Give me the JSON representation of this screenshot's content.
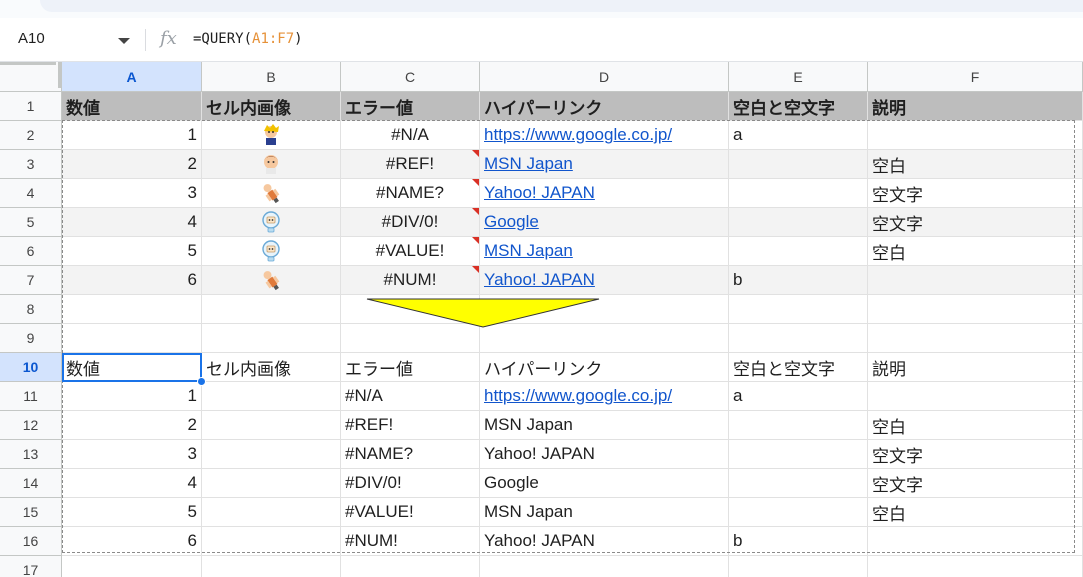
{
  "name_box": {
    "value": "A10"
  },
  "formula_bar": {
    "prefix": "=QUERY(",
    "range": "A1:F7",
    "suffix": ")"
  },
  "columns": [
    "A",
    "B",
    "C",
    "D",
    "E",
    "F"
  ],
  "rows": [
    "1",
    "2",
    "3",
    "4",
    "5",
    "6",
    "7",
    "8",
    "9",
    "10",
    "11",
    "12",
    "13",
    "14",
    "15",
    "16",
    "17"
  ],
  "header": [
    "数値",
    "セル内画像",
    "エラー値",
    "ハイパーリンク",
    "空白と空文字",
    "説明"
  ],
  "source_rows": [
    {
      "num": "1",
      "image": "anime-character-icon-1",
      "error": "#N/A",
      "link": "https://www.google.co.jp/",
      "blank": "a",
      "desc": ""
    },
    {
      "num": "2",
      "image": "anime-character-icon-2",
      "error": "#REF!",
      "link": "MSN Japan",
      "blank": "",
      "desc": "空白"
    },
    {
      "num": "3",
      "image": "anime-character-icon-3",
      "error": "#NAME?",
      "link": "Yahoo! JAPAN",
      "blank": "",
      "desc": "空文字"
    },
    {
      "num": "4",
      "image": "robot-icon",
      "error": "#DIV/0!",
      "link": "Google",
      "blank": "",
      "desc": "空文字"
    },
    {
      "num": "5",
      "image": "robot-icon",
      "error": "#VALUE!",
      "link": "MSN Japan",
      "blank": "",
      "desc": "空白"
    },
    {
      "num": "6",
      "image": "anime-character-icon-3",
      "error": "#NUM!",
      "link": "Yahoo! JAPAN",
      "blank": "b",
      "desc": ""
    }
  ],
  "result_header": [
    "数値",
    "セル内画像",
    "エラー値",
    "ハイパーリンク",
    "空白と空文字",
    "説明"
  ],
  "result_rows": [
    {
      "num": "1",
      "error": "#N/A",
      "link": "https://www.google.co.jp/",
      "link_is_url": true,
      "blank": "a",
      "desc": ""
    },
    {
      "num": "2",
      "error": "#REF!",
      "link": "MSN Japan",
      "link_is_url": false,
      "blank": "",
      "desc": "空白"
    },
    {
      "num": "3",
      "error": "#NAME?",
      "link": "Yahoo! JAPAN",
      "link_is_url": false,
      "blank": "",
      "desc": "空文字"
    },
    {
      "num": "4",
      "error": "#DIV/0!",
      "link": "Google",
      "link_is_url": false,
      "blank": "",
      "desc": "空文字"
    },
    {
      "num": "5",
      "error": "#VALUE!",
      "link": "MSN Japan",
      "link_is_url": false,
      "blank": "",
      "desc": "空白"
    },
    {
      "num": "6",
      "error": "#NUM!",
      "link": "Yahoo! JAPAN",
      "link_is_url": false,
      "blank": "b",
      "desc": ""
    }
  ],
  "colors": {
    "header_bg": "#bdbdbd",
    "band_bg": "#f3f3f3",
    "link": "#1155cc",
    "selection": "#1a73e8",
    "arrow": "#ffff00"
  }
}
